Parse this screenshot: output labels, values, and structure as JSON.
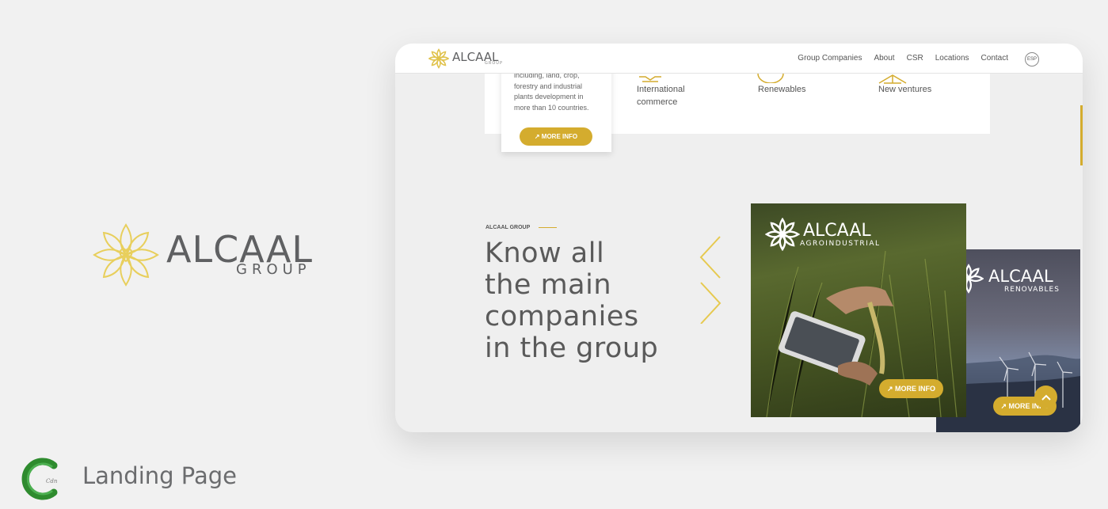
{
  "brand": {
    "name": "ALCAAL",
    "sub": "GROUP",
    "nav_sub": "GROUP"
  },
  "badge": {
    "label": "Landing Page"
  },
  "nav": {
    "menu": [
      "Group Companies",
      "About",
      "CSR",
      "Locations",
      "Contact"
    ],
    "lang": "ESP"
  },
  "card": {
    "text": "including, land, crop, forestry and industrial plants development in more than 10 countries.",
    "button": "↗ MORE INFO"
  },
  "features": [
    {
      "label_line1": "International",
      "label_line2": "commerce",
      "icon": "handshake-icon"
    },
    {
      "label_line1": "Renewables",
      "label_line2": "",
      "icon": "energy-icon"
    },
    {
      "label_line1": "New ventures",
      "label_line2": "",
      "icon": "network-icon"
    }
  ],
  "section": {
    "eyebrow": "ALCAAL GROUP",
    "headline_lines": [
      "Know all",
      "the main",
      "companies",
      "in the group"
    ]
  },
  "companies": [
    {
      "name": "ALCAAL",
      "division": "AGROINDUSTRIAL",
      "button": "↗ MORE INFO"
    },
    {
      "name": "ALCAAL",
      "division": "RENOVABLES",
      "button": "↗ MORE INFO"
    }
  ],
  "colors": {
    "accent": "#d4ac2e",
    "text": "#5a5a5a",
    "background": "#f1f1f1"
  }
}
